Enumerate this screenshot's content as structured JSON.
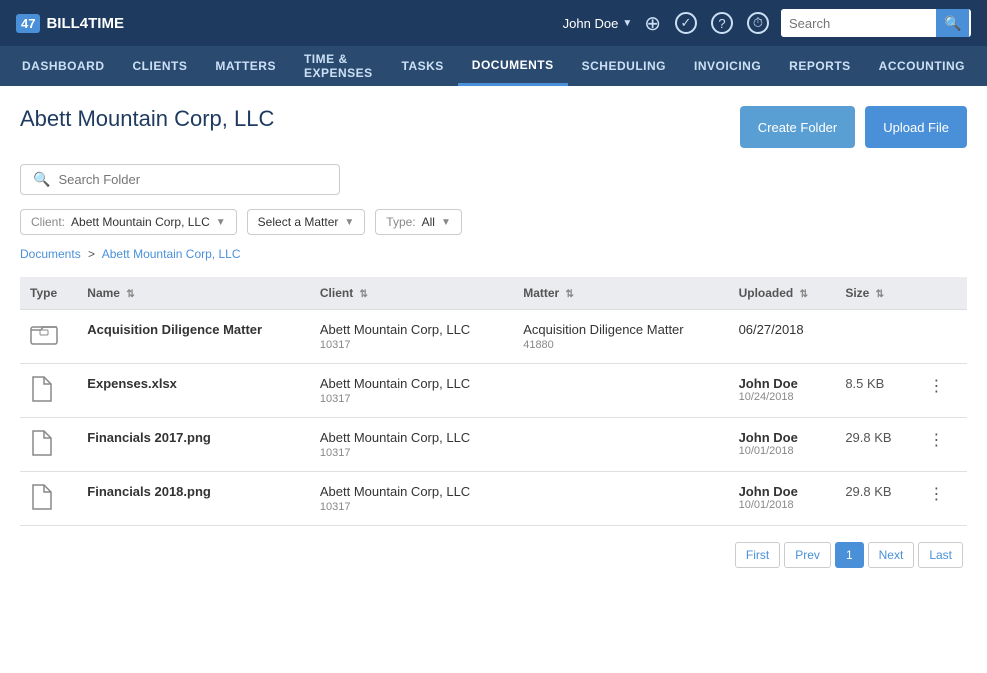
{
  "topBar": {
    "logoText": "BILL4TIME",
    "userName": "John Doe",
    "searchPlaceholder": "Search"
  },
  "mainNav": {
    "items": [
      {
        "label": "DASHBOARD",
        "active": false
      },
      {
        "label": "CLIENTS",
        "active": false
      },
      {
        "label": "MATTERS",
        "active": false
      },
      {
        "label": "TIME & EXPENSES",
        "active": false
      },
      {
        "label": "TASKS",
        "active": false
      },
      {
        "label": "DOCUMENTS",
        "active": true
      },
      {
        "label": "SCHEDULING",
        "active": false
      },
      {
        "label": "INVOICING",
        "active": false
      },
      {
        "label": "REPORTS",
        "active": false
      },
      {
        "label": "ACCOUNTING",
        "active": false
      }
    ]
  },
  "page": {
    "title": "Abett Mountain Corp, LLC",
    "createFolderBtn": "Create Folder",
    "uploadFileBtn": "Upload File",
    "searchFolderPlaceholder": "Search Folder"
  },
  "filters": {
    "clientLabel": "Client:",
    "clientValue": "Abett Mountain Corp, LLC",
    "matterLabel": "Select a Matter",
    "typeLabel": "Type:",
    "typeValue": "All"
  },
  "breadcrumb": {
    "root": "Documents",
    "separator": ">",
    "current": "Abett Mountain Corp, LLC"
  },
  "tableHeaders": [
    {
      "label": "Type",
      "sortable": false
    },
    {
      "label": "Name",
      "sortable": true
    },
    {
      "label": "Client",
      "sortable": true
    },
    {
      "label": "Matter",
      "sortable": true
    },
    {
      "label": "Uploaded",
      "sortable": true
    },
    {
      "label": "Size",
      "sortable": true
    }
  ],
  "tableRows": [
    {
      "type": "folder",
      "name": "Acquisition Diligence Matter",
      "client": "Abett Mountain Corp, LLC",
      "clientId": "10317",
      "matter": "Acquisition Diligence Matter",
      "matterId": "41880",
      "uploaded": "06/27/2018",
      "uploader": null,
      "size": null,
      "hasMenu": false
    },
    {
      "type": "file",
      "name": "Expenses.xlsx",
      "client": "Abett Mountain Corp, LLC",
      "clientId": "10317",
      "matter": null,
      "matterId": null,
      "uploaded": "10/24/2018",
      "uploader": "John Doe",
      "size": "8.5 KB",
      "hasMenu": true
    },
    {
      "type": "file",
      "name": "Financials 2017.png",
      "client": "Abett Mountain Corp, LLC",
      "clientId": "10317",
      "matter": null,
      "matterId": null,
      "uploaded": "10/01/2018",
      "uploader": "John Doe",
      "size": "29.8 KB",
      "hasMenu": true
    },
    {
      "type": "file",
      "name": "Financials 2018.png",
      "client": "Abett Mountain Corp, LLC",
      "clientId": "10317",
      "matter": null,
      "matterId": null,
      "uploaded": "10/01/2018",
      "uploader": "John Doe",
      "size": "29.8 KB",
      "hasMenu": true
    }
  ],
  "pagination": {
    "first": "First",
    "prev": "Prev",
    "current": "1",
    "next": "Next",
    "last": "Last"
  }
}
